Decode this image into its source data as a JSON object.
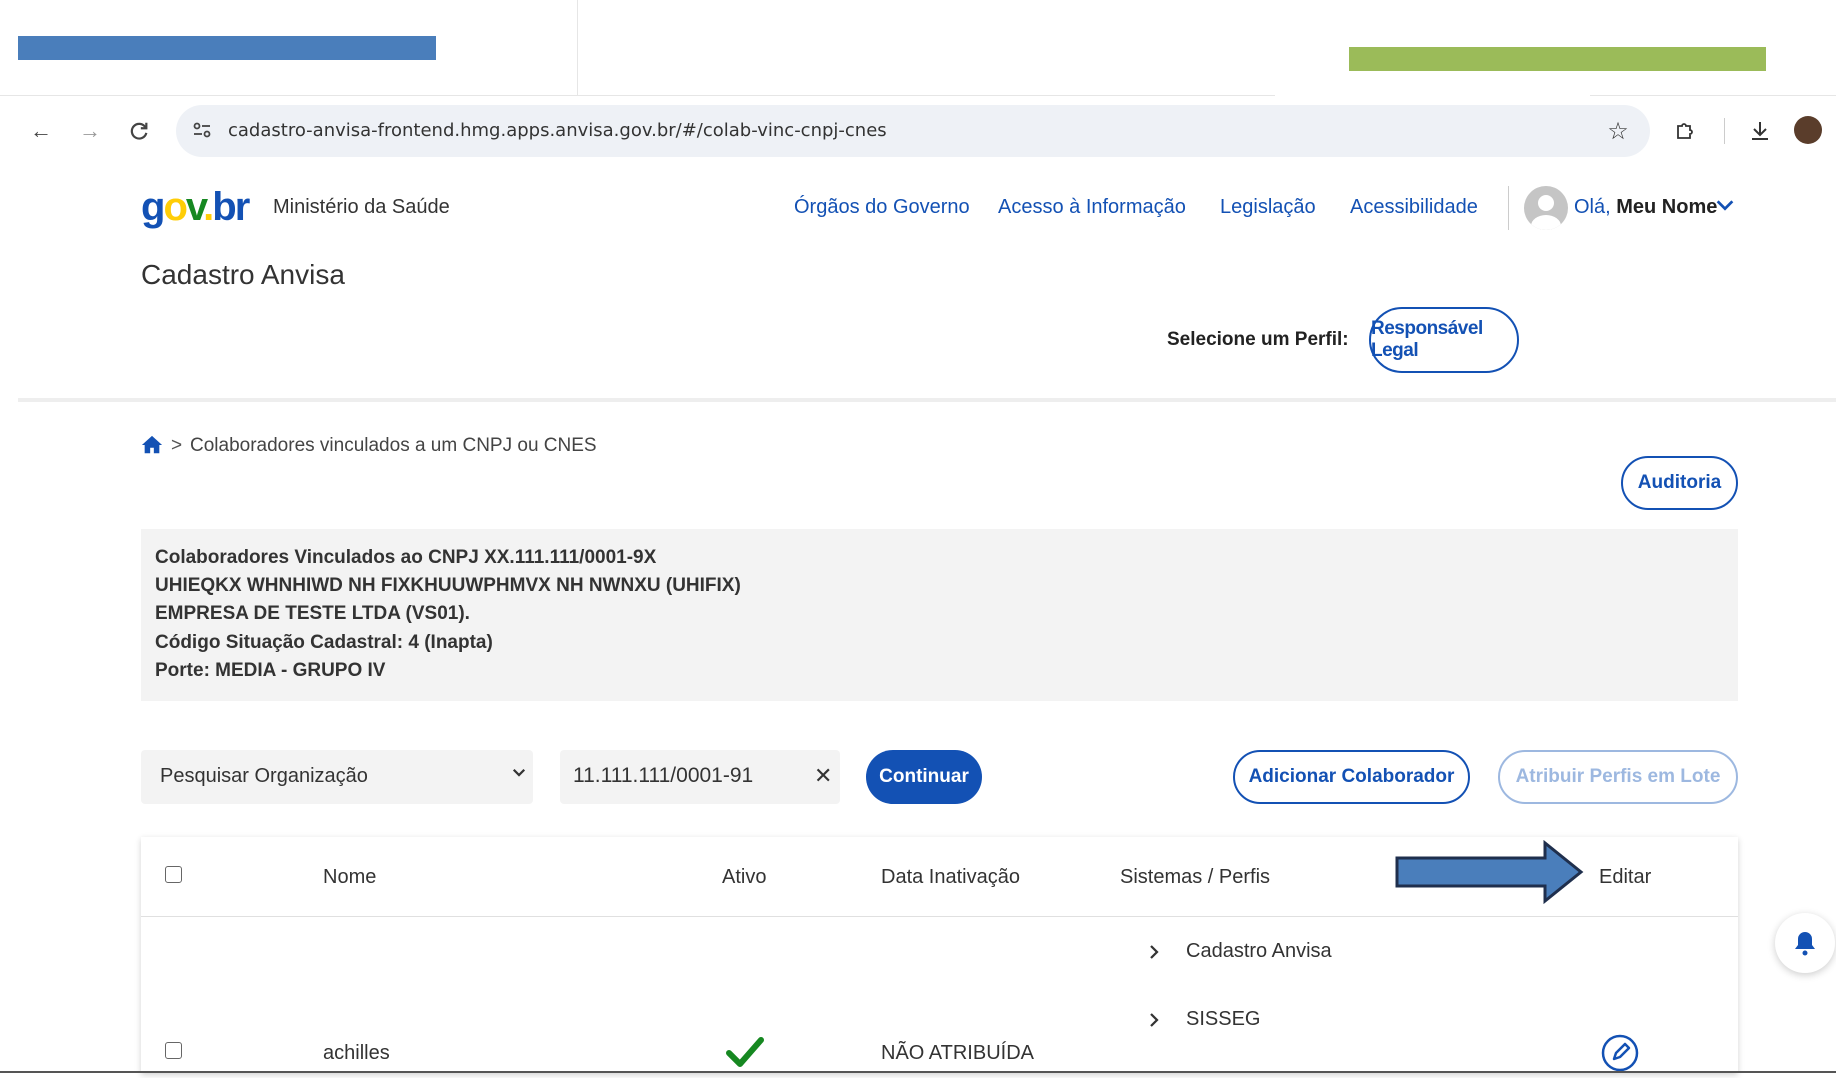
{
  "browser": {
    "url": "cadastro-anvisa-frontend.hmg.apps.anvisa.gov.br/#/colab-vinc-cnpj-cnes"
  },
  "header": {
    "logo": {
      "g": "g",
      "o": "o",
      "v": "v",
      "dot": ".",
      "br": "br"
    },
    "ministry": "Ministério da Saúde",
    "nav": [
      "Órgãos do Governo",
      "Acesso à Informação",
      "Legislação",
      "Acessibilidade"
    ],
    "greeting": "Olá,",
    "user_name": "Meu Nome",
    "app_title": "Cadastro Anvisa",
    "profile_label": "Selecione um Perfil:",
    "profile_value": "Responsável Legal"
  },
  "breadcrumb": {
    "separator": ">",
    "current": "Colaboradores vinculados a um CNPJ ou CNES"
  },
  "actions": {
    "audit": "Auditoria",
    "add_collaborator": "Adicionar Colaborador",
    "assign_profiles": "Atribuir Perfis em Lote",
    "continue": "Continuar"
  },
  "info": {
    "lines": [
      "Colaboradores Vinculados ao CNPJ XX.111.111/0001-9X",
      "UHIEQKX WHNHIWD NH FIXKHUUWPHMVX NH NWNXU (UHIFIX)",
      "EMPRESA DE TESTE LTDA (VS01).",
      "Código Situação Cadastral: 4 (Inapta)",
      "Porte: MEDIA - GRUPO IV"
    ]
  },
  "filter": {
    "select_value": "Pesquisar Organização",
    "search_value": "11.111.111/0001-91"
  },
  "table": {
    "columns": [
      "Nome",
      "Ativo",
      "Data Inativação",
      "Sistemas / Perfis",
      "Editar"
    ],
    "rows": [
      {
        "name": "achilles",
        "active": true,
        "inactivation_date": "NÃO ATRIBUÍDA",
        "systems": [
          "Cadastro Anvisa",
          "SISSEG"
        ]
      }
    ]
  },
  "colors": {
    "primary": "#1351b4",
    "annotation_blue": "#4a7ebb",
    "annotation_green": "#9bbb59",
    "check_green": "#168821"
  }
}
